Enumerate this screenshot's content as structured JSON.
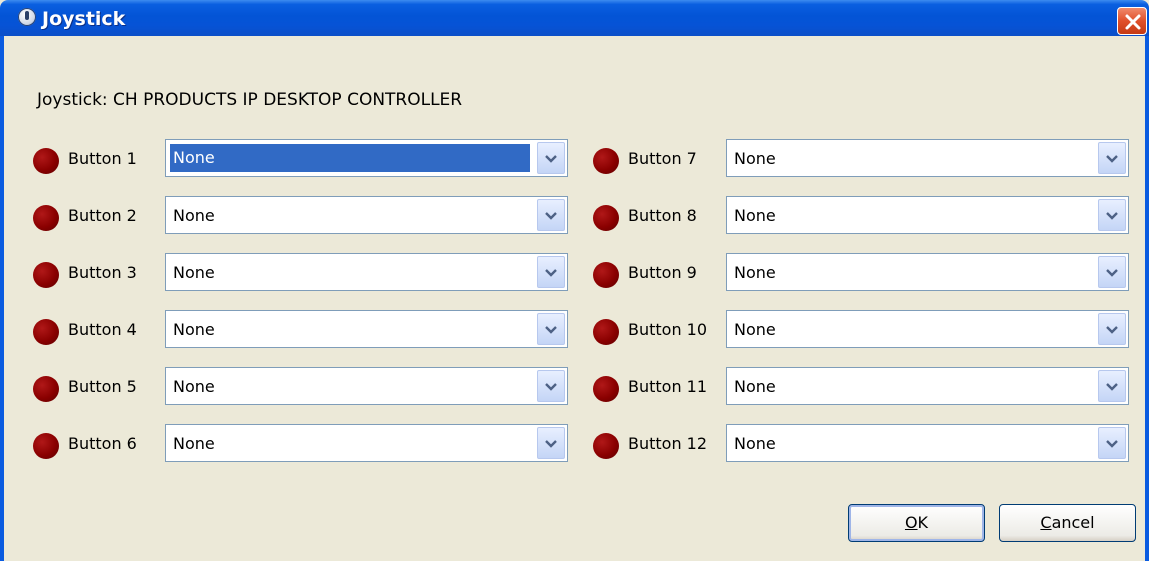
{
  "window": {
    "title": "Joystick",
    "title_color": "#0553d6",
    "background": "#ece9d8"
  },
  "device_label": "Joystick: CH PRODUCTS IP DESKTOP CONTROLLER",
  "led_color": "#8a0000",
  "buttons_left": [
    {
      "label": "Button 1",
      "value": "None",
      "selected": true
    },
    {
      "label": "Button 2",
      "value": "None"
    },
    {
      "label": "Button 3",
      "value": "None"
    },
    {
      "label": "Button 4",
      "value": "None"
    },
    {
      "label": "Button 5",
      "value": "None"
    },
    {
      "label": "Button 6",
      "value": "None"
    }
  ],
  "buttons_right": [
    {
      "label": "Button 7",
      "value": "None"
    },
    {
      "label": "Button 8",
      "value": "None"
    },
    {
      "label": "Button 9",
      "value": "None"
    },
    {
      "label": "Button 10",
      "value": "None"
    },
    {
      "label": "Button 11",
      "value": "None"
    },
    {
      "label": "Button 12",
      "value": "None"
    }
  ],
  "actions": {
    "ok": {
      "mnemonic": "O",
      "rest": "K"
    },
    "cancel": {
      "mnemonic": "C",
      "rest": "ancel"
    }
  }
}
